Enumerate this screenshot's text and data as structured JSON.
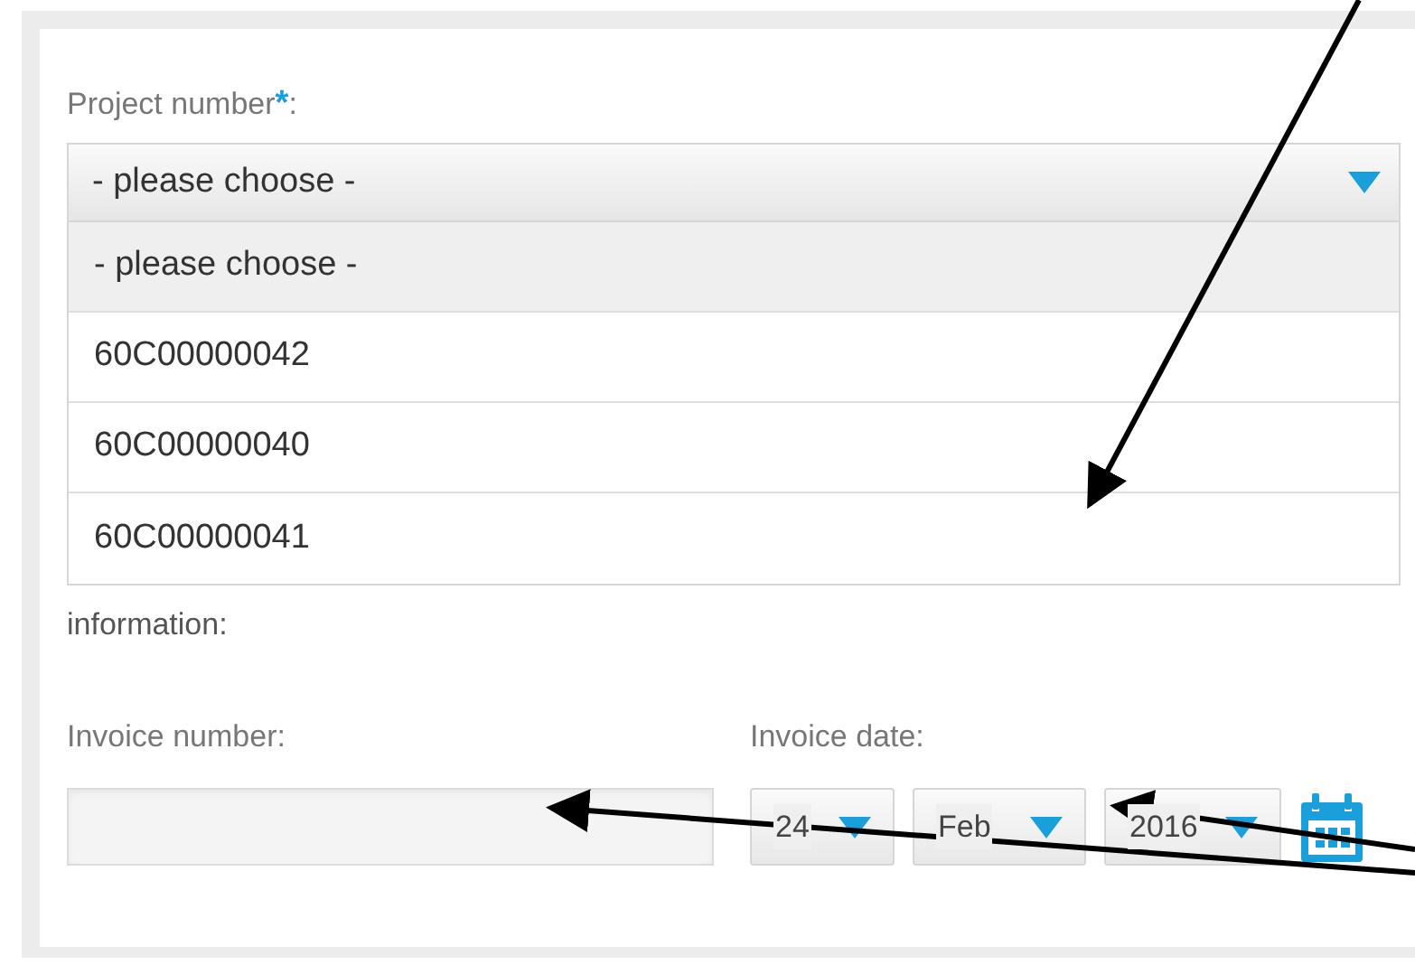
{
  "project_field": {
    "label": "Project number",
    "required_mark": "*",
    "label_suffix": ":",
    "value": "- please choose -",
    "expanded": true,
    "options": [
      {
        "label": "- please choose -",
        "selected": true
      },
      {
        "label": "60C00000042",
        "selected": false
      },
      {
        "label": "60C00000040",
        "selected": false
      },
      {
        "label": "60C00000041",
        "selected": false
      }
    ]
  },
  "hint": "information:",
  "invoice_number": {
    "label": "Invoice number:"
  },
  "invoice_date": {
    "label": "Invoice date:",
    "day": "24",
    "month": "Feb",
    "year": "2016"
  }
}
